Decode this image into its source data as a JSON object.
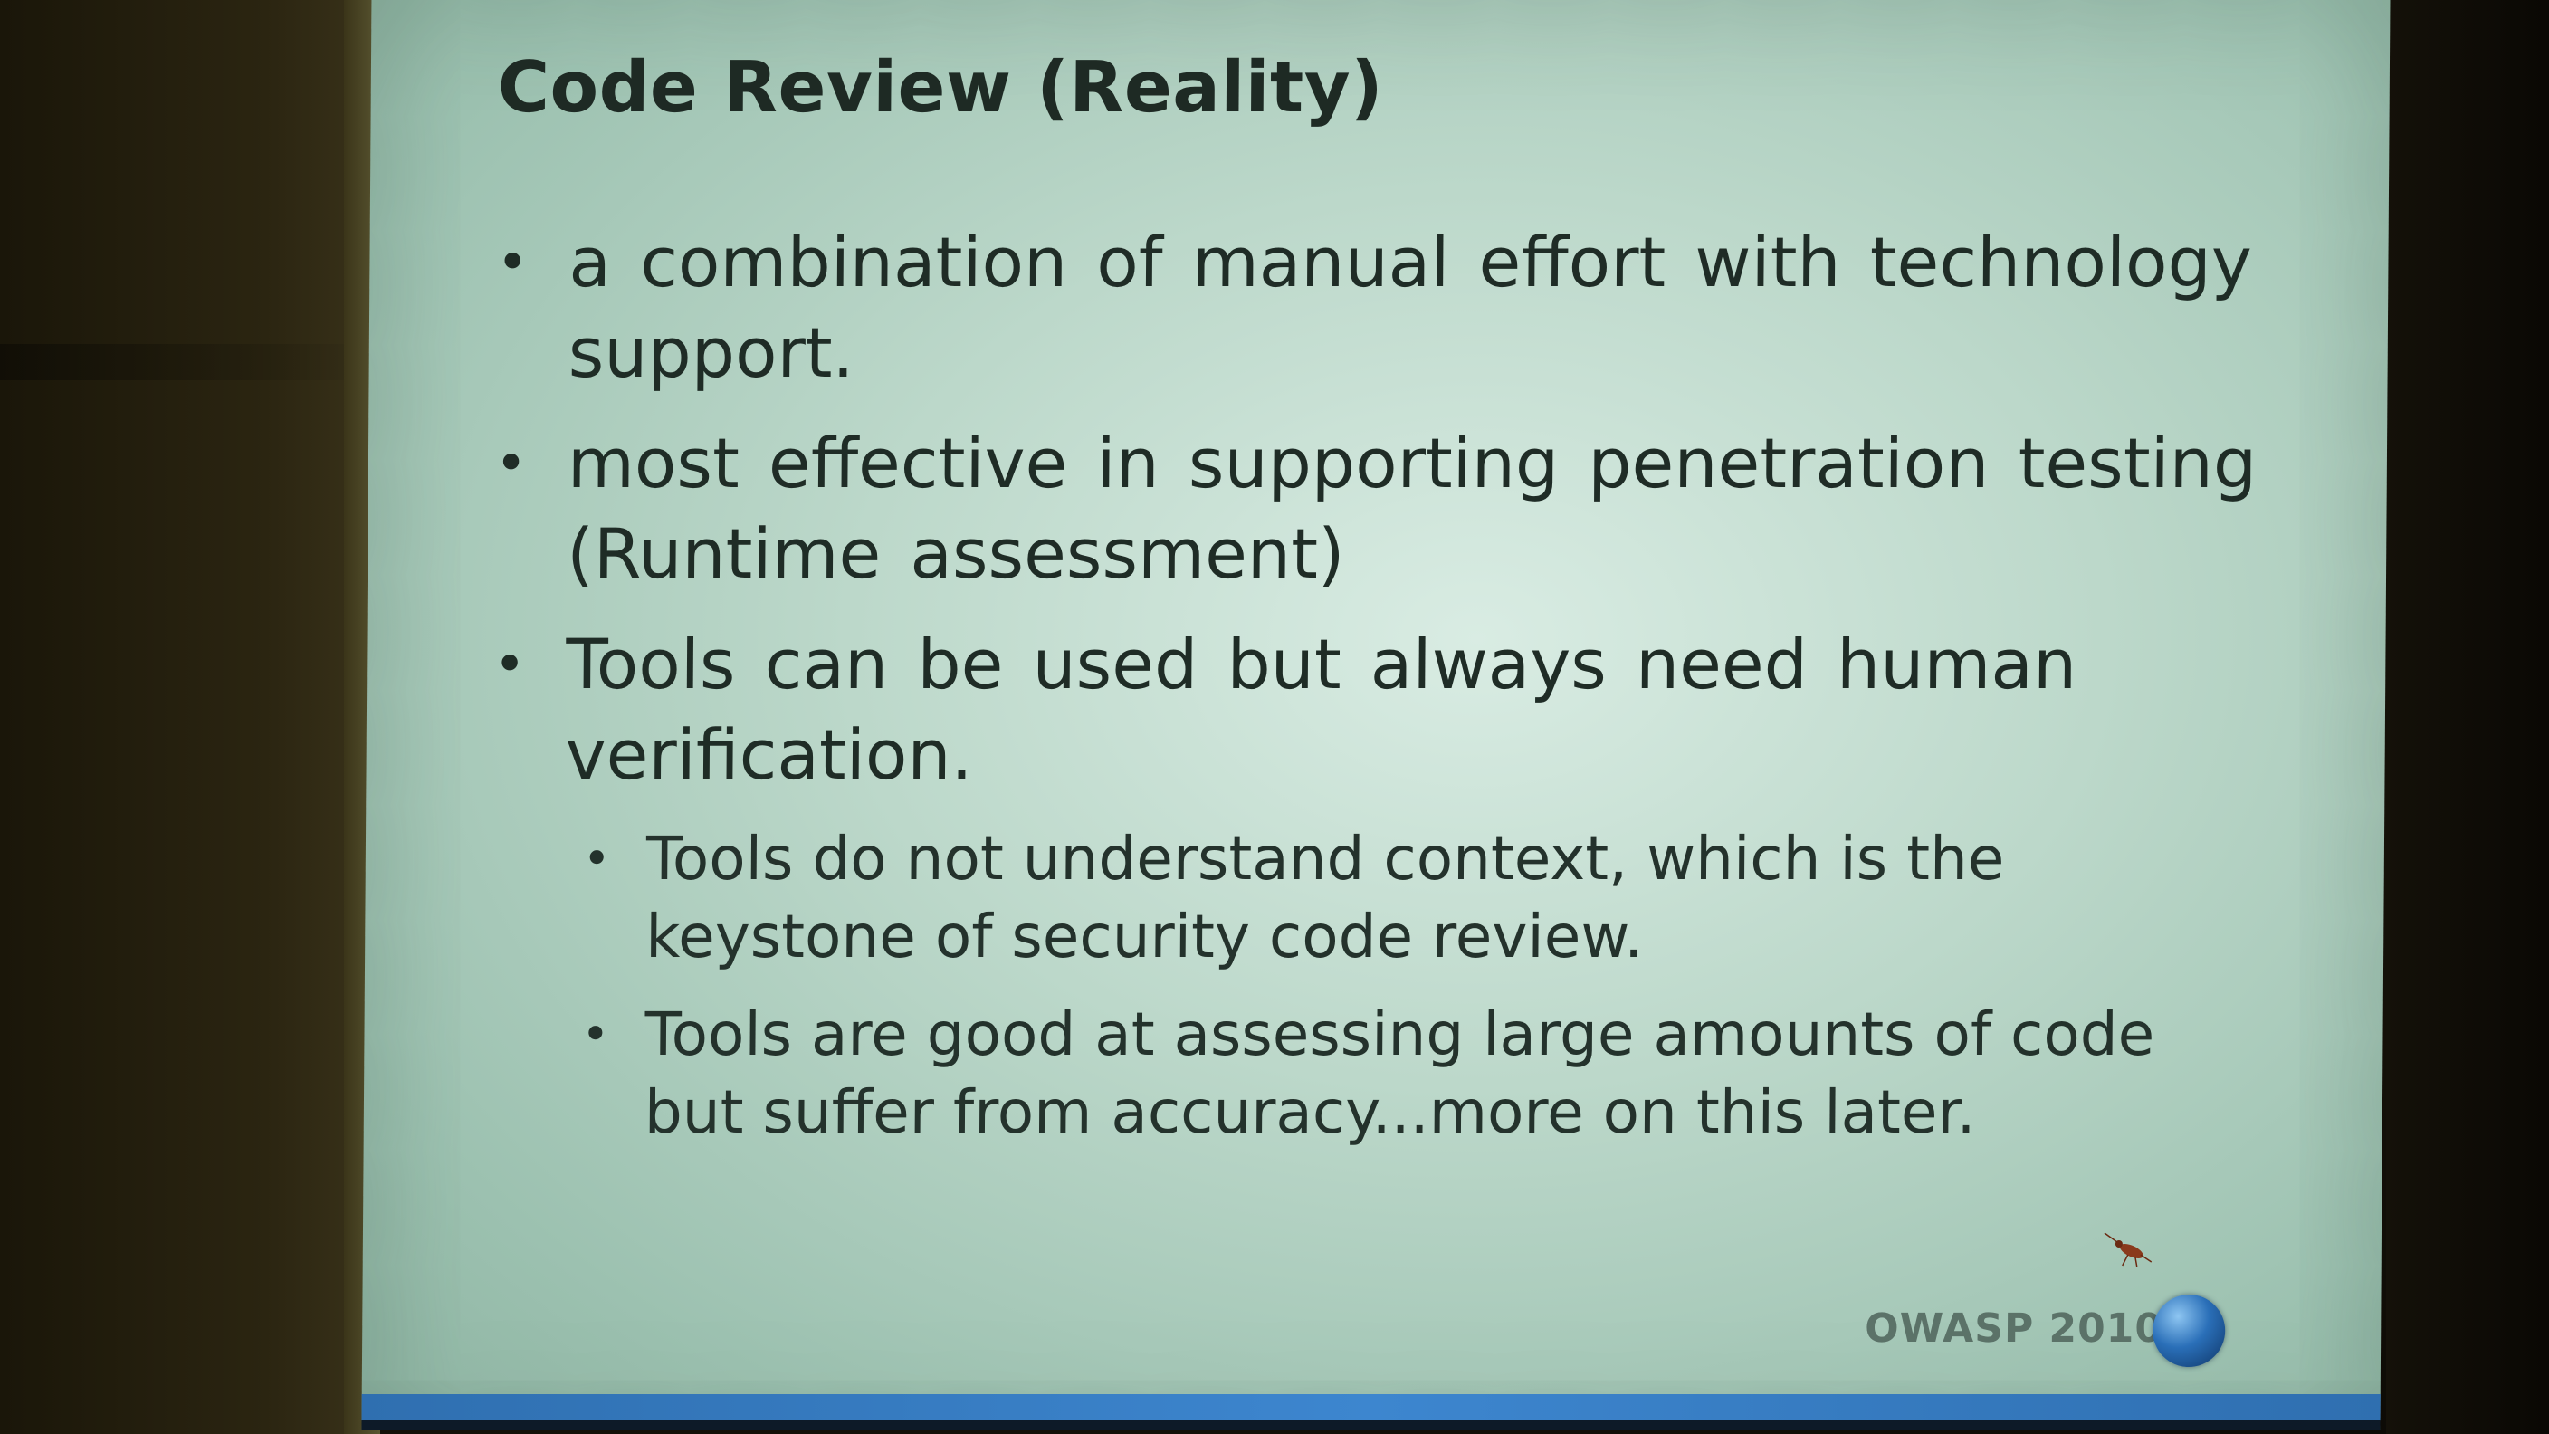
{
  "slide": {
    "title": "Code Review (Reality)",
    "bullets": [
      {
        "line1": "a combination of manual effort with technology",
        "line2": "support."
      },
      {
        "line1": "most effective in supporting penetration testing",
        "line2": "(Runtime assessment)"
      },
      {
        "line1": "Tools can be used but always need human",
        "line2": "verification."
      }
    ],
    "sub_bullets": [
      {
        "line1": "Tools do not understand context, which is the",
        "line2": "keystone of security code review."
      },
      {
        "line1": "Tools are good at assessing large amounts of code",
        "line2": "but suffer from accuracy...more on this later."
      }
    ],
    "footer": "OWASP 2010",
    "bullet_glyph": "•",
    "icons": [
      "globe-icon",
      "insect-icon"
    ],
    "colors": {
      "slide_background": "#c8e0d4",
      "title_text": "#1e2a24",
      "body_text": "#1f2c26",
      "footer_text": "#5b7268",
      "bottom_bar": "#3d86cf",
      "globe": "#2a6fb8"
    }
  }
}
